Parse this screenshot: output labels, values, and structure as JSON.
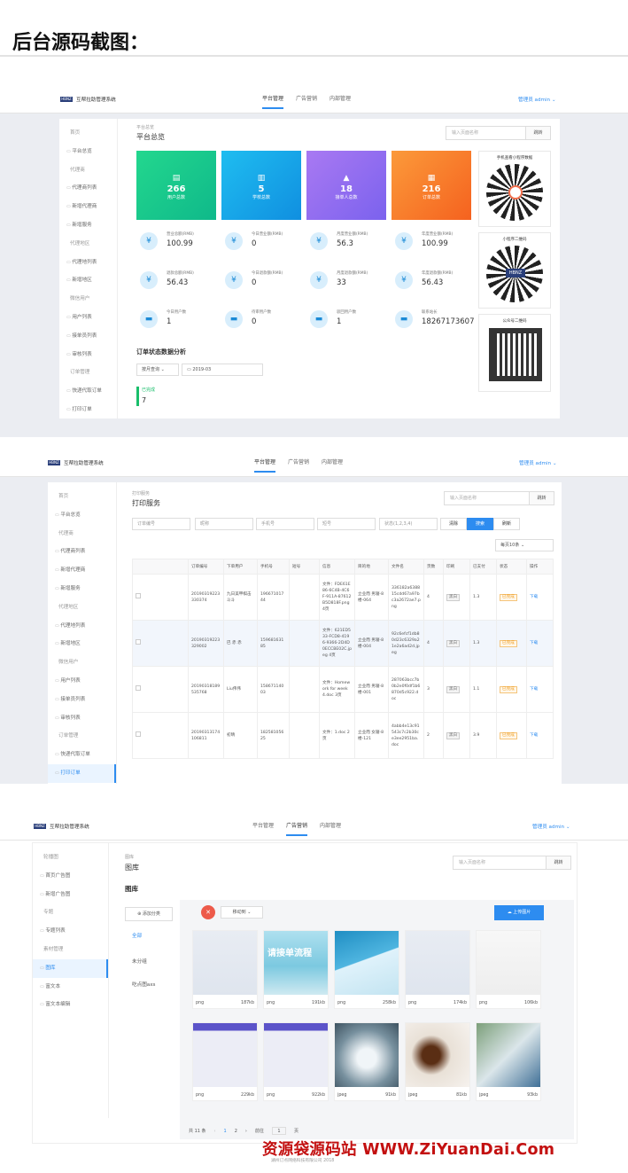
{
  "page_title": "后台源码截图：",
  "app": {
    "logo_mark": "HBNZ",
    "name": "互帮拉助管理系统",
    "nav": [
      "平台管理",
      "广告营销",
      "内部管理"
    ],
    "user": "管理员 admin"
  },
  "s1": {
    "side": [
      {
        "t": "首页",
        "k": "grp"
      },
      {
        "t": "平台总览",
        "k": "sub"
      },
      {
        "t": "代理商",
        "k": "grp"
      },
      {
        "t": "代理商列表",
        "k": "sub"
      },
      {
        "t": "新增代理商",
        "k": "sub"
      },
      {
        "t": "新增服务",
        "k": "sub"
      },
      {
        "t": "代理地区",
        "k": "grp"
      },
      {
        "t": "代理地列表",
        "k": "sub"
      },
      {
        "t": "新增地区",
        "k": "sub"
      },
      {
        "t": "微信用户",
        "k": "grp"
      },
      {
        "t": "用户列表",
        "k": "sub"
      },
      {
        "t": "接单员列表",
        "k": "sub"
      },
      {
        "t": "审核列表",
        "k": "sub"
      },
      {
        "t": "订单管理",
        "k": "grp"
      },
      {
        "t": "快递代取订单",
        "k": "sub"
      },
      {
        "t": "打印订单",
        "k": "sub"
      }
    ],
    "crumb": "平台总览",
    "heading": "平台总览",
    "search_ph": "输入页面名称",
    "search_btn": "跳转",
    "tiles": [
      {
        "icon": "▤",
        "value": "266",
        "label": "用户总数"
      },
      {
        "icon": "▥",
        "value": "5",
        "label": "学校总数"
      },
      {
        "icon": "▲",
        "value": "18",
        "label": "接单人总数"
      },
      {
        "icon": "▦",
        "value": "216",
        "label": "订单总数"
      }
    ],
    "stats": [
      {
        "label": "营业总额(RMB)",
        "value": "100.99",
        "icon": "¥"
      },
      {
        "label": "今日营业额(RMB)",
        "value": "0",
        "icon": "¥"
      },
      {
        "label": "月度营业额(RMB)",
        "value": "56.3",
        "icon": "¥"
      },
      {
        "label": "年度营业额(RMB)",
        "value": "100.99",
        "icon": "¥"
      },
      {
        "label": "退款总额(RMB)",
        "value": "56.43",
        "icon": "¥"
      },
      {
        "label": "今日退款额(RMB)",
        "value": "0",
        "icon": "¥"
      },
      {
        "label": "月度退款额(RMB)",
        "value": "33",
        "icon": "¥"
      },
      {
        "label": "年度退款额(RMB)",
        "value": "56.43",
        "icon": "¥"
      },
      {
        "label": "今日用户数",
        "value": "1",
        "icon": "▬"
      },
      {
        "label": "待审用户数",
        "value": "0",
        "icon": "▬"
      },
      {
        "label": "驳回用户数",
        "value": "1",
        "icon": "▬"
      },
      {
        "label": "联系站长",
        "value": "18267173607",
        "icon": "▬"
      }
    ],
    "analysis_title": "订单状态数据分析",
    "query_select": "按月查询",
    "month": "2019-03",
    "done_label": "已完成",
    "done_value": "7",
    "qr_titles": [
      "手机查看小程序数据",
      "小程序二维码",
      "公众号二维码"
    ]
  },
  "s2": {
    "side": [
      {
        "t": "首页",
        "k": "grp"
      },
      {
        "t": "平台总览",
        "k": "sub"
      },
      {
        "t": "代理商",
        "k": "grp"
      },
      {
        "t": "代理商列表",
        "k": "sub"
      },
      {
        "t": "新增代理商",
        "k": "sub"
      },
      {
        "t": "新增服务",
        "k": "sub"
      },
      {
        "t": "代理地区",
        "k": "grp"
      },
      {
        "t": "代理地列表",
        "k": "sub"
      },
      {
        "t": "新增地区",
        "k": "sub"
      },
      {
        "t": "微信用户",
        "k": "grp"
      },
      {
        "t": "用户列表",
        "k": "sub"
      },
      {
        "t": "接单员列表",
        "k": "sub"
      },
      {
        "t": "审核列表",
        "k": "sub"
      },
      {
        "t": "订单管理",
        "k": "grp"
      },
      {
        "t": "快递代取订单",
        "k": "sub"
      },
      {
        "t": "打印订单",
        "k": "act"
      }
    ],
    "crumb": "打印服务",
    "heading": "打印服务",
    "search_ph": "输入页面名称",
    "search_btn": "跳转",
    "filters": [
      "订单编号",
      "昵称",
      "手机号",
      "短号",
      "状态(1,2,3,4)"
    ],
    "btn_clear": "清除",
    "btn_search": "搜索",
    "btn_refresh": "刷新",
    "page_size": "每页10条",
    "columns": [
      "",
      "订单编号",
      "下单用户",
      "手机号",
      "短号",
      "信息",
      "目的地",
      "文件名",
      "页数",
      "印刷",
      "已支付",
      "状态",
      "操作"
    ],
    "rows": [
      [
        "20190319223330374",
        "九日美甲棋击斗斗",
        "19667101744",
        "",
        "文件：FDE61E86-6C4B-4C6F-911A-87612B5D818F.png 4页",
        "立业而 男寝-8楼-064",
        "336182a638815cdd67a97bc3a2672ae7.png",
        "4",
        "黑白",
        "1.3",
        "已完成",
        "下载"
      ],
      [
        "20190319223329002",
        "巴 赤 赤",
        "15968163185",
        "",
        "文件：621ED533-FCD8-4196-9366-2D4D0ECCBE02C.jpeg 4页",
        "立业而 男寝-8楼-004",
        "92c6efcf1db80d23c6329a21e2a6ad2d.jpeg",
        "4",
        "黑白",
        "1.3",
        "已完成",
        "下载"
      ],
      [
        "20190318189535768",
        "Liu伟伟",
        "15867114003",
        "",
        "文件：Homework for week 4.doc 3页",
        "立业而 男寝-8楼-001",
        "287063bcc7b0b2e0f0df1b6870d5c922.doc",
        "3",
        "黑白",
        "1.1",
        "已完成",
        "下载"
      ],
      [
        "20190313174106811",
        "初晴",
        "18258105625",
        "",
        "文件：1.doc 2页",
        "立业而 女寝-8楼-121",
        "4abb4e13c91543c7c2b30ce3ee2951ba.doc",
        "2",
        "黑白",
        "3.9",
        "已完成",
        "下载"
      ]
    ]
  },
  "s3": {
    "side": [
      {
        "t": "轮播图",
        "k": "grp"
      },
      {
        "t": "首页广告图",
        "k": "sub"
      },
      {
        "t": "新增广告图",
        "k": "sub"
      },
      {
        "t": "专题",
        "k": "grp"
      },
      {
        "t": "专题列表",
        "k": "sub"
      },
      {
        "t": "素材管理",
        "k": "grp"
      },
      {
        "t": "图库",
        "k": "act"
      },
      {
        "t": "富文本",
        "k": "sub"
      },
      {
        "t": "富文本编辑",
        "k": "sub"
      }
    ],
    "crumb": "图库",
    "heading": "图库",
    "search_ph": "输入页面名称",
    "search_btn": "跳转",
    "section_title": "图库",
    "add_category": "添加分类",
    "categories": [
      "全部",
      "未分组",
      "吃点图axs"
    ],
    "delete_icon": "trash-icon",
    "move_to": "移动到",
    "upload": "上传图片",
    "images": [
      {
        "type": "png",
        "size": "187kb"
      },
      {
        "type": "png",
        "size": "191kb"
      },
      {
        "type": "png",
        "size": "258kb"
      },
      {
        "type": "png",
        "size": "174kb"
      },
      {
        "type": "png",
        "size": "106kb"
      },
      {
        "type": "png",
        "size": "229kb"
      },
      {
        "type": "png",
        "size": "922kb"
      },
      {
        "type": "jpeg",
        "size": "91kb"
      },
      {
        "type": "jpeg",
        "size": "81kb"
      },
      {
        "type": "jpeg",
        "size": "93kb"
      }
    ],
    "banner_text": "请接单流程",
    "pager": {
      "total": "共 11 条",
      "pages": [
        "1",
        "2"
      ],
      "goto": "前往",
      "page": "1",
      "unit": "页"
    },
    "copyright": "湖州订点网络科技有限公司 2018"
  },
  "watermark": "资源袋源码站 WWW.ZiYuanDai.Com",
  "colors": {
    "tile1": "#19c98b",
    "tile2": "#14a6e6",
    "tile3": "#8f6cf0",
    "tile4": "#f9782d",
    "accent": "#2d8cf0",
    "brand_red": "#c31010"
  }
}
